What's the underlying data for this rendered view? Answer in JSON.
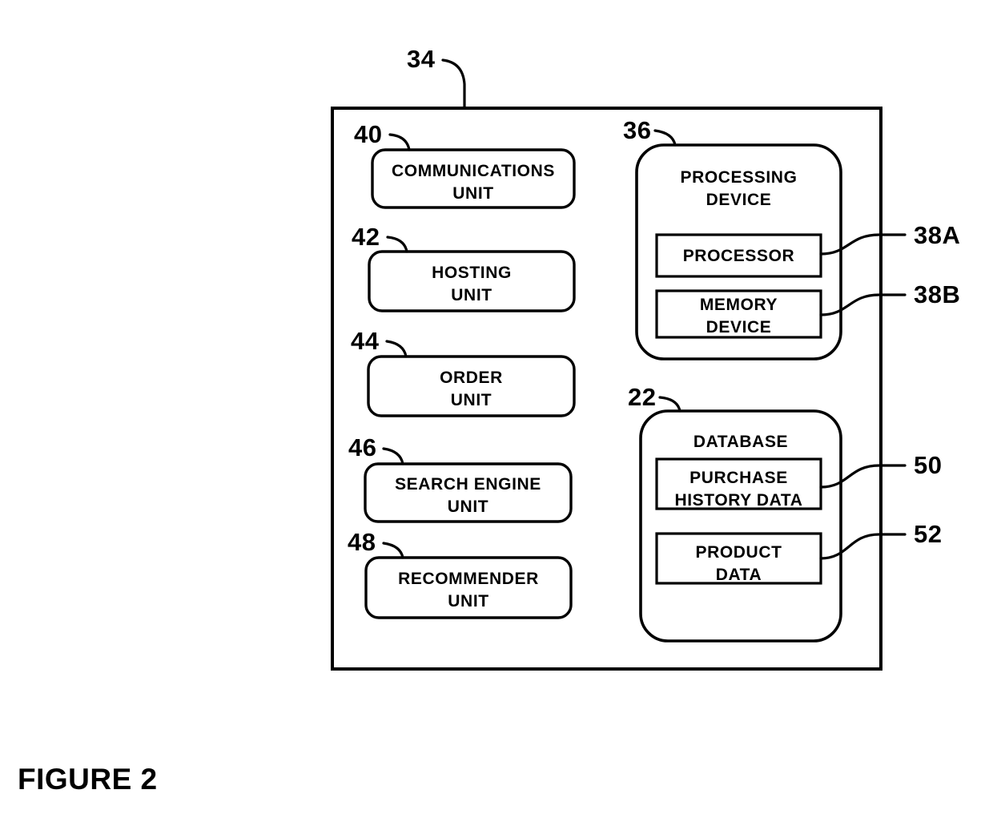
{
  "figure": {
    "caption": "FIGURE 2",
    "system_ref": "34"
  },
  "outer_container": {
    "ref": "34",
    "name": "system-container"
  },
  "left_column": {
    "units": [
      {
        "ref": "40",
        "label": "COMMUNICATIONS\nUNIT"
      },
      {
        "ref": "42",
        "label": "HOSTING\nUNIT"
      },
      {
        "ref": "44",
        "label": "ORDER\nUNIT"
      },
      {
        "ref": "46",
        "label": "SEARCH ENGINE\nUNIT"
      },
      {
        "ref": "48",
        "label": "RECOMMENDER\nUNIT"
      }
    ]
  },
  "right_column": {
    "processing_device": {
      "ref": "36",
      "label": "PROCESSING\nDEVICE",
      "children": [
        {
          "ref": "38A",
          "label": "PROCESSOR"
        },
        {
          "ref": "38B",
          "label": "MEMORY\nDEVICE"
        }
      ]
    },
    "database": {
      "ref": "22",
      "label": "DATABASE",
      "children": [
        {
          "ref": "50",
          "label": "PURCHASE\nHISTORY DATA"
        },
        {
          "ref": "52",
          "label": "PRODUCT\nDATA"
        }
      ]
    }
  },
  "style": {
    "line_color": "#000000",
    "background": "#ffffff"
  }
}
